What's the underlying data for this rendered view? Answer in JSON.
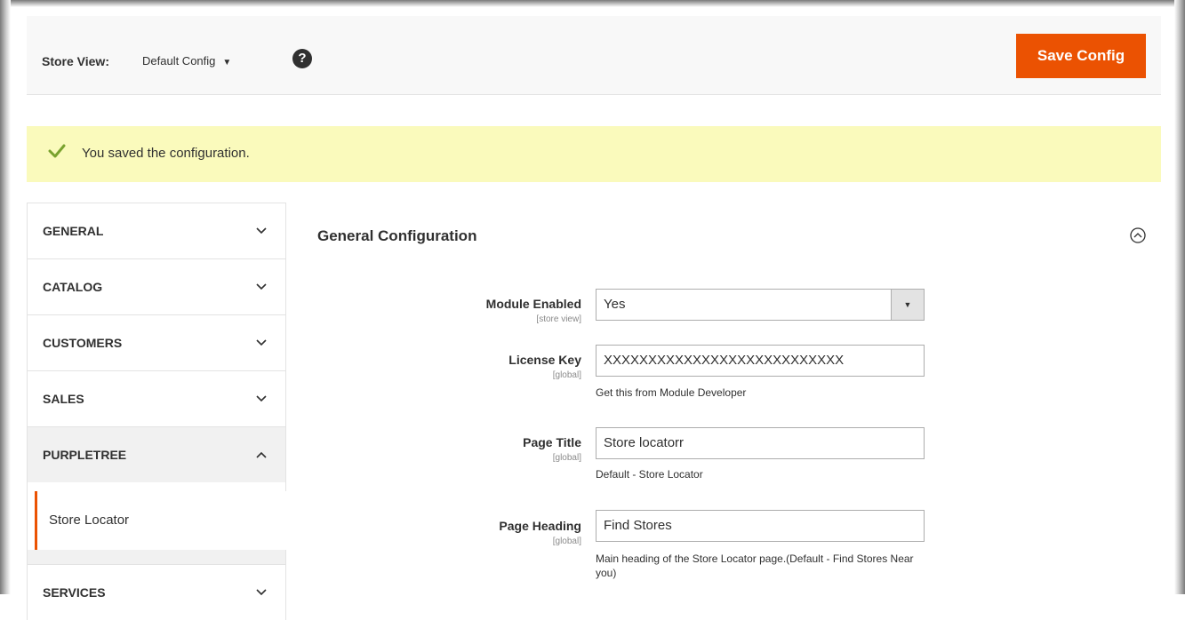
{
  "header": {
    "store_view_label": "Store View:",
    "store_view_value": "Default Config",
    "save_button_label": "Save Config"
  },
  "message": {
    "text": "You saved the configuration."
  },
  "sidebar": {
    "tabs": [
      {
        "label": "GENERAL"
      },
      {
        "label": "CATALOG"
      },
      {
        "label": "CUSTOMERS"
      },
      {
        "label": "SALES"
      },
      {
        "label": "PURPLETREE"
      },
      {
        "label": "SERVICES"
      }
    ],
    "open_tab_item": "Store Locator"
  },
  "section": {
    "title": "General Configuration"
  },
  "fields": {
    "module_enabled": {
      "label": "Module Enabled",
      "scope": "[store view]",
      "value": "Yes"
    },
    "license_key": {
      "label": "License Key",
      "scope": "[global]",
      "value": "XXXXXXXXXXXXXXXXXXXXXXXXXXX",
      "note": "Get this from Module Developer"
    },
    "page_title": {
      "label": "Page Title",
      "scope": "[global]",
      "value": "Store locatorr",
      "note": "Default - Store Locator"
    },
    "page_heading": {
      "label": "Page Heading",
      "scope": "[global]",
      "value": "Find Stores",
      "note": "Main heading of the Store Locator page.(Default - Find Stores Near you)"
    }
  },
  "colors": {
    "accent": "#eb5202",
    "success_bg": "#fafabc",
    "success_check": "#79a22e"
  }
}
